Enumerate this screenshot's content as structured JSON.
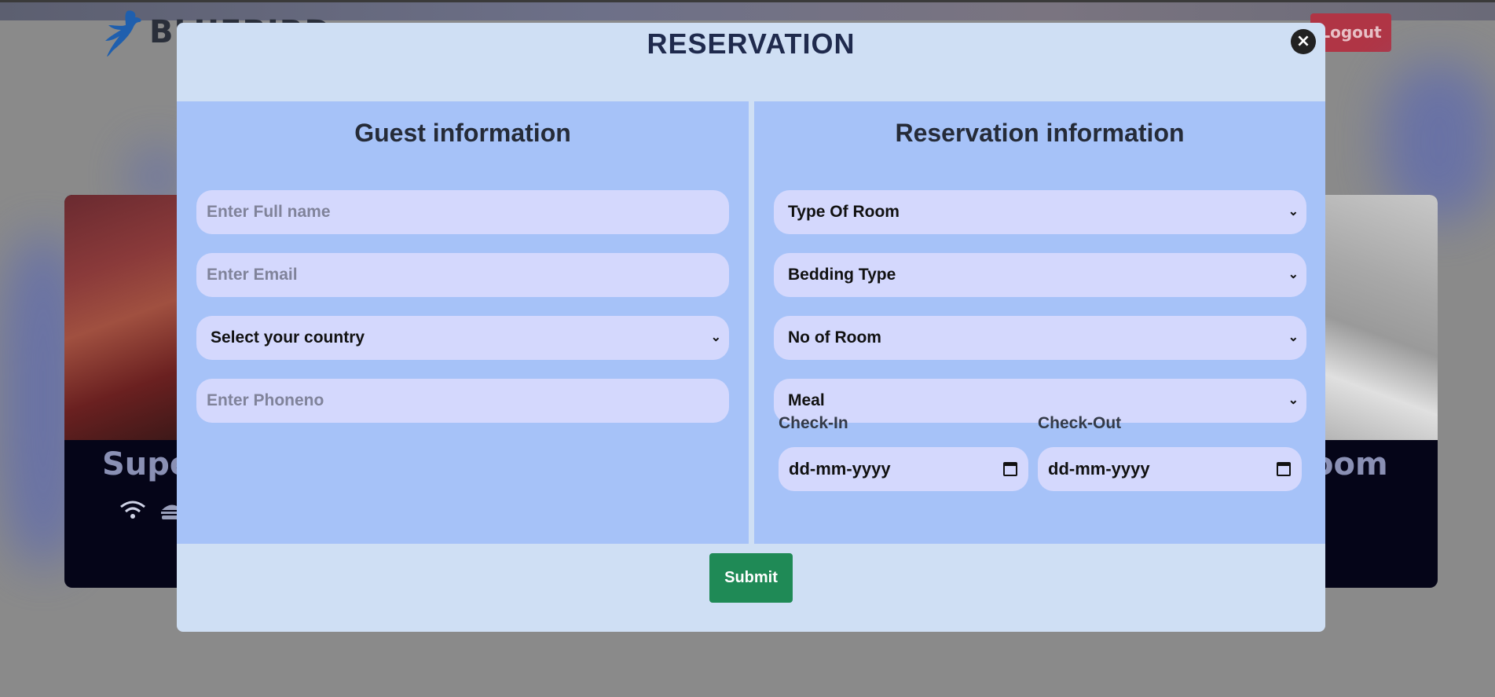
{
  "header": {
    "logo_text": "BLUEBIRD",
    "logout_label": "Logout"
  },
  "background_cards": {
    "left_title": "Supe",
    "right_title": "oom"
  },
  "modal": {
    "title": "RESERVATION",
    "close_label": "×",
    "guest": {
      "heading": "Guest information",
      "fullname_placeholder": "Enter Full name",
      "email_placeholder": "Enter Email",
      "country_value": "Select your country",
      "phone_placeholder": "Enter Phoneno"
    },
    "reservation": {
      "heading": "Reservation information",
      "room_type_value": "Type Of Room",
      "bedding_value": "Bedding Type",
      "room_count_value": "No of Room",
      "meal_value": "Meal",
      "checkin_label": "Check-In",
      "checkout_label": "Check-Out",
      "checkin_value": "dd-mm-yyyy",
      "checkout_value": "dd-mm-yyyy"
    },
    "submit_label": "Submit"
  },
  "colors": {
    "modal_bg": "#cfdff4",
    "panel_bg": "#a6c2f8",
    "field_bg": "#d4d8fd",
    "submit_bg": "#1f8a56",
    "logout_bg": "#b03545"
  }
}
